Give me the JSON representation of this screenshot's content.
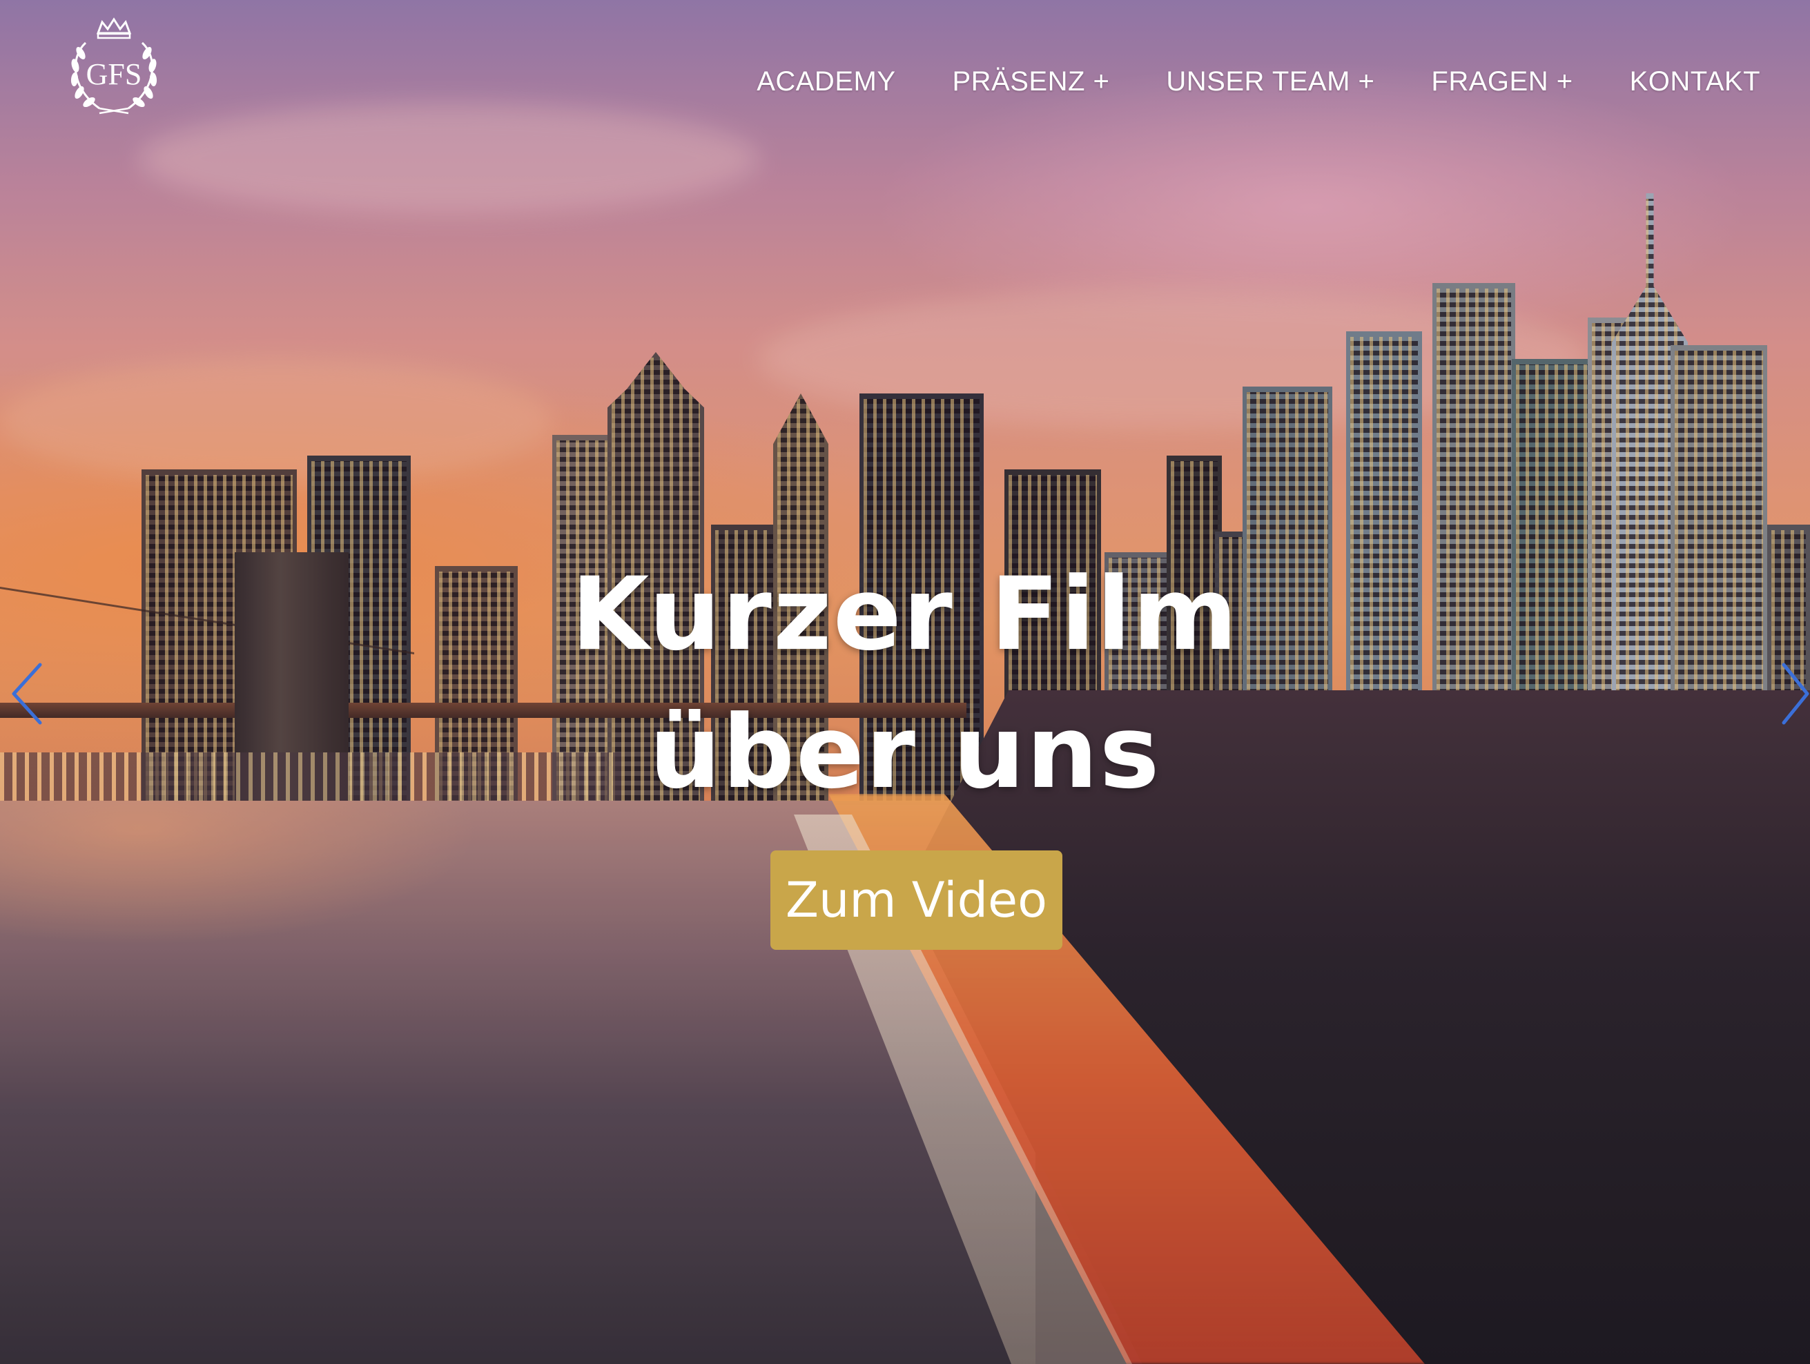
{
  "logo": {
    "text": "GFS",
    "icon": "crown-laurel-logo-icon"
  },
  "nav": {
    "items": [
      {
        "label": "ACADEMY"
      },
      {
        "label": "PRÄSENZ +"
      },
      {
        "label": "UNSER TEAM +"
      },
      {
        "label": "FRAGEN +"
      },
      {
        "label": "KONTAKT"
      }
    ]
  },
  "hero": {
    "headline_line1": "Kurzer Film",
    "headline_line2": "über uns",
    "cta_label": "Zum Video",
    "background_icon": "city-skyline-sunset-image",
    "prev_icon": "chevron-left-icon",
    "next_icon": "chevron-right-icon"
  },
  "colors": {
    "cta_background": "#c9a64a",
    "text": "#ffffff",
    "arrow": "#3b6fd8"
  }
}
